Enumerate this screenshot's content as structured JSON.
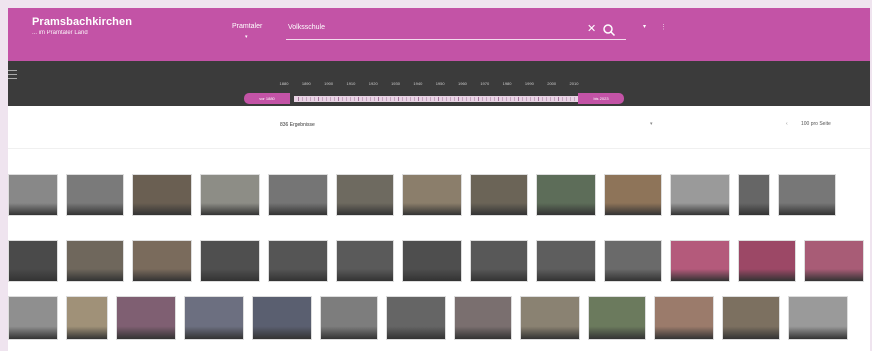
{
  "header": {
    "brand_title": "Pramsbachkirchen",
    "brand_sub": "... im Pramtaler Land",
    "scope_label": "Pramtaler",
    "search_value": "Volksschule",
    "clear_icon": "close-icon",
    "search_icon": "search-icon",
    "menu_caret": "▾",
    "more_icon": "⋮",
    "accent": "#c353a6"
  },
  "timeline": {
    "menu_icon": "menu-icon",
    "years": [
      "1880",
      "1890",
      "1900",
      "1910",
      "1920",
      "1930",
      "1940",
      "1950",
      "1960",
      "1970",
      "1980",
      "1990",
      "2000",
      "2010"
    ],
    "range_start": "vor 1880",
    "range_end": "bis 2023"
  },
  "results": {
    "count_label": "836 Ergebnisse",
    "sort_caret": "▾",
    "page_prev": "‹",
    "per_page_label": "100 pro Seite"
  },
  "grid": {
    "rows": [
      [
        {
          "tone": "#888888"
        },
        {
          "tone": "#7a7a7a"
        },
        {
          "tone": "#6a5f52"
        },
        {
          "tone": "#8d8d86"
        },
        {
          "tone": "#757575"
        },
        {
          "tone": "#6e6a60"
        },
        {
          "tone": "#8b7e6b"
        },
        {
          "tone": "#6b6457"
        },
        {
          "tone": "#5d6d59"
        },
        {
          "tone": "#8e7459"
        },
        {
          "tone": "#9a9a9a"
        },
        {
          "tone": "#666666"
        },
        {
          "tone": "#777777"
        },
        {
          "tone": "#858585"
        }
      ],
      [
        {
          "tone": "#4a4a4a"
        },
        {
          "tone": "#6f675c"
        },
        {
          "tone": "#7a6b5c"
        },
        {
          "tone": "#4f4f4f"
        },
        {
          "tone": "#555555"
        },
        {
          "tone": "#5a5a5a"
        },
        {
          "tone": "#4e4e4e"
        },
        {
          "tone": "#585858"
        },
        {
          "tone": "#5e5e5e"
        },
        {
          "tone": "#6a6a6a"
        },
        {
          "tone": "#b45a7b"
        },
        {
          "tone": "#9c4866"
        },
        {
          "tone": "#a85c76"
        },
        {
          "tone": "#8f5268"
        }
      ],
      [
        {
          "tone": "#8f8f8f"
        },
        {
          "tone": "#a09178"
        },
        {
          "tone": "#7f5f72"
        },
        {
          "tone": "#6c6f80"
        },
        {
          "tone": "#5a5f70"
        },
        {
          "tone": "#7d7d7d"
        },
        {
          "tone": "#656565"
        },
        {
          "tone": "#7a6f6f"
        },
        {
          "tone": "#8a8272"
        },
        {
          "tone": "#6b7a5d"
        },
        {
          "tone": "#9b7b6b"
        },
        {
          "tone": "#7c7060"
        },
        {
          "tone": "#9a9a9a"
        },
        {
          "tone": "#707070"
        },
        {
          "tone": "#808080"
        }
      ]
    ]
  }
}
